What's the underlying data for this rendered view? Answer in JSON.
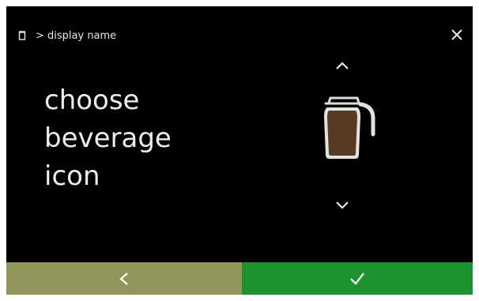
{
  "header": {
    "icon": "cup-icon",
    "breadcrumb": "> display name",
    "close_icon": "close-icon"
  },
  "main": {
    "title_lines": [
      "choose",
      "beverage",
      "icon"
    ],
    "selected_icon": "coffee-carafe-icon",
    "up_icon": "chevron-up-icon",
    "down_icon": "chevron-down-icon"
  },
  "footer": {
    "back_icon": "chevron-left-icon",
    "confirm_icon": "checkmark-icon"
  },
  "colors": {
    "screen_background": "#000000",
    "back_button": "#92955c",
    "confirm_button": "#1e9231",
    "text": "#ececec",
    "coffee": "#5a3a22"
  }
}
